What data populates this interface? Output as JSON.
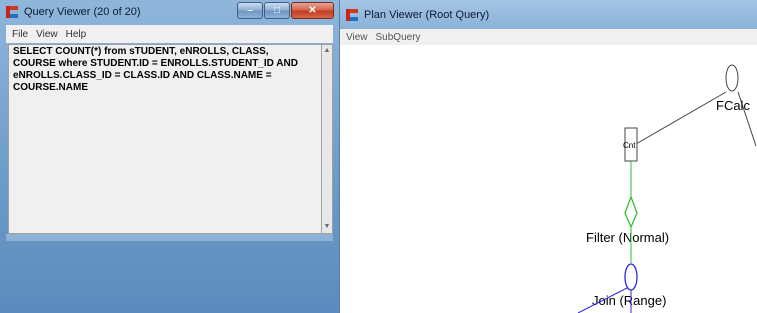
{
  "query_viewer": {
    "title": "Query Viewer (20 of 20)",
    "menu": [
      "File",
      "View",
      "Help"
    ],
    "query_text": "SELECT COUNT(*) from sTUDENT, eNROLLS, CLASS,\nCOURSE where STUDENT.ID = ENROLLS.STUDENT_ID AND\neNROLLS.CLASS_ID = CLASS.ID AND CLASS.NAME =\nCOURSE.NAME",
    "buttons": {
      "minimize": "–",
      "maximize": "□",
      "close": "✕"
    }
  },
  "plan_viewer": {
    "title": "Plan Viewer (Root Query)",
    "menu": [
      "View",
      "SubQuery"
    ],
    "nodes": {
      "fcalc": "FCalc",
      "cnt": "Cnt",
      "filter": "Filter (Normal)",
      "join": "Join (Range)"
    }
  },
  "colors": {
    "filter_edge": "#2fbf2f",
    "join_edge": "#2a2ad6",
    "root_edge": "#444444"
  }
}
